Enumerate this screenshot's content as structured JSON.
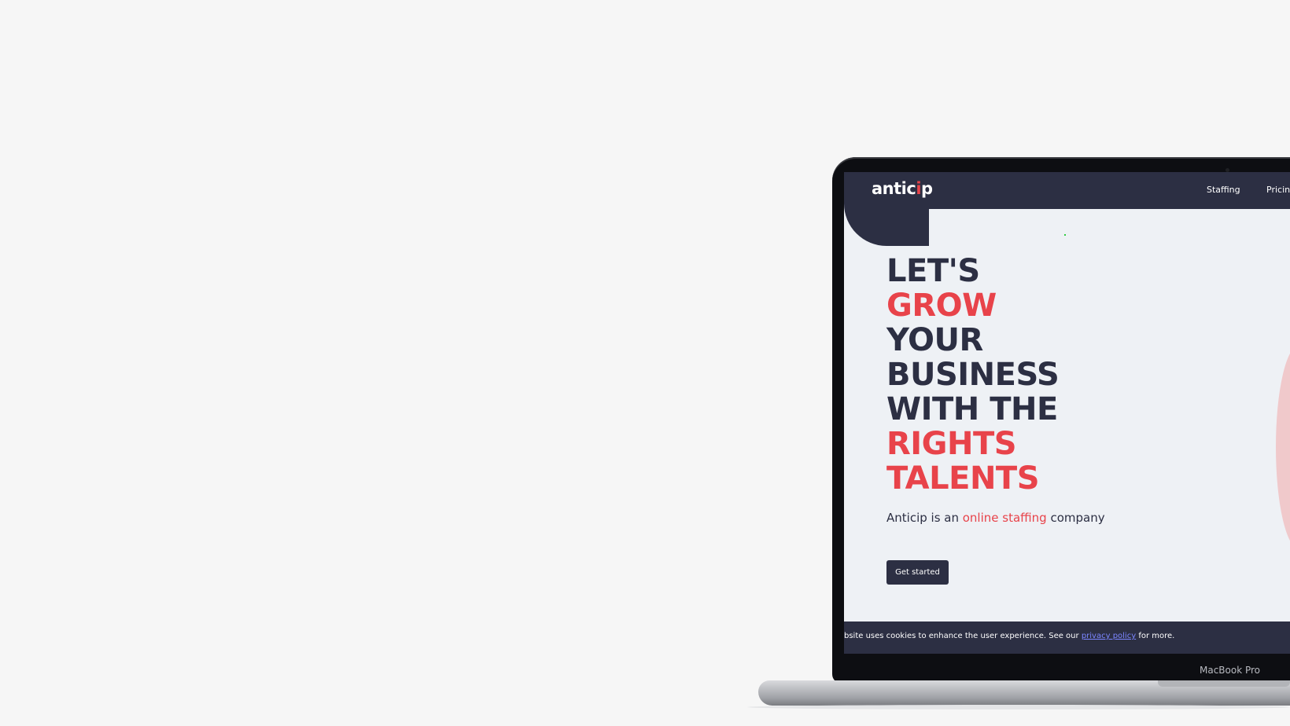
{
  "logo": {
    "text_start": "antic",
    "text_dot": "i",
    "text_end": "p"
  },
  "nav": {
    "items": [
      {
        "label": "Staffing"
      },
      {
        "label": "Pricing"
      }
    ]
  },
  "hero": {
    "lines": [
      "LET'S",
      "GROW",
      "YOUR",
      "BUSINESS",
      "WITH THE",
      "RIGHTS",
      "TALENTS"
    ],
    "subtitle_start": "Anticip is an ",
    "subtitle_accent": "online staffing",
    "subtitle_end": " company",
    "cta_label": "Get started"
  },
  "cookie": {
    "text_start": "bsite uses cookies to enhance the user experience. See our ",
    "link_label": "privacy policy",
    "text_end": " for more."
  },
  "device": {
    "label": "MacBook Pro"
  },
  "colors": {
    "navy": "#2c2f43",
    "accent": "#e8434a",
    "link": "#7b86ff"
  }
}
